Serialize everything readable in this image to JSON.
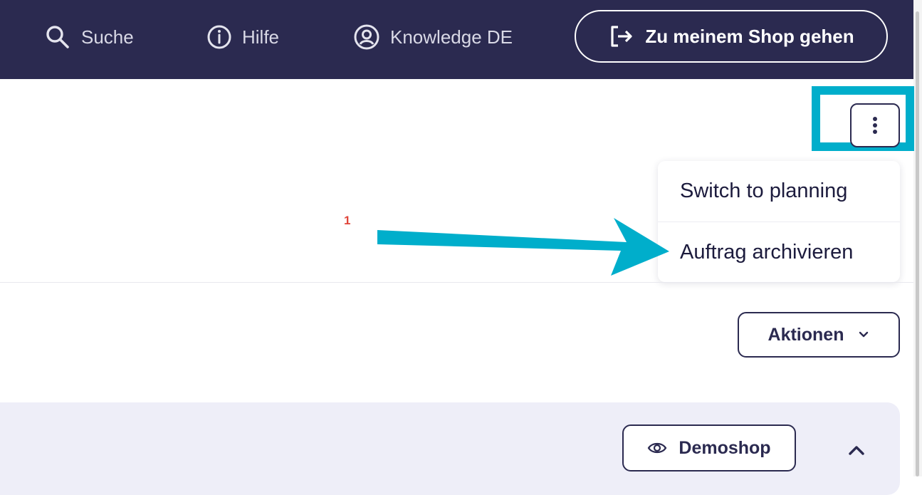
{
  "topbar": {
    "search_label": "Suche",
    "help_label": "Hilfe",
    "knowledge_label": "Knowledge DE",
    "shop_button_label": "Zu meinem Shop gehen"
  },
  "menu": {
    "items": [
      {
        "label": "Switch to planning"
      },
      {
        "label": "Auftrag archivieren"
      }
    ]
  },
  "annotation": {
    "number": "1"
  },
  "actions": {
    "aktionen_label": "Aktionen",
    "demoshop_label": "Demoshop"
  },
  "colors": {
    "topbar_bg": "#2b2a50",
    "highlight": "#00aecb",
    "annotation_number": "#e0453a",
    "panel_bg": "#eeeef8"
  },
  "icons": [
    "search-icon",
    "info-icon",
    "user-circle-icon",
    "logout-arrow-icon",
    "kebab-vertical-icon",
    "chevron-down-icon",
    "eye-icon",
    "chevron-up-icon"
  ]
}
